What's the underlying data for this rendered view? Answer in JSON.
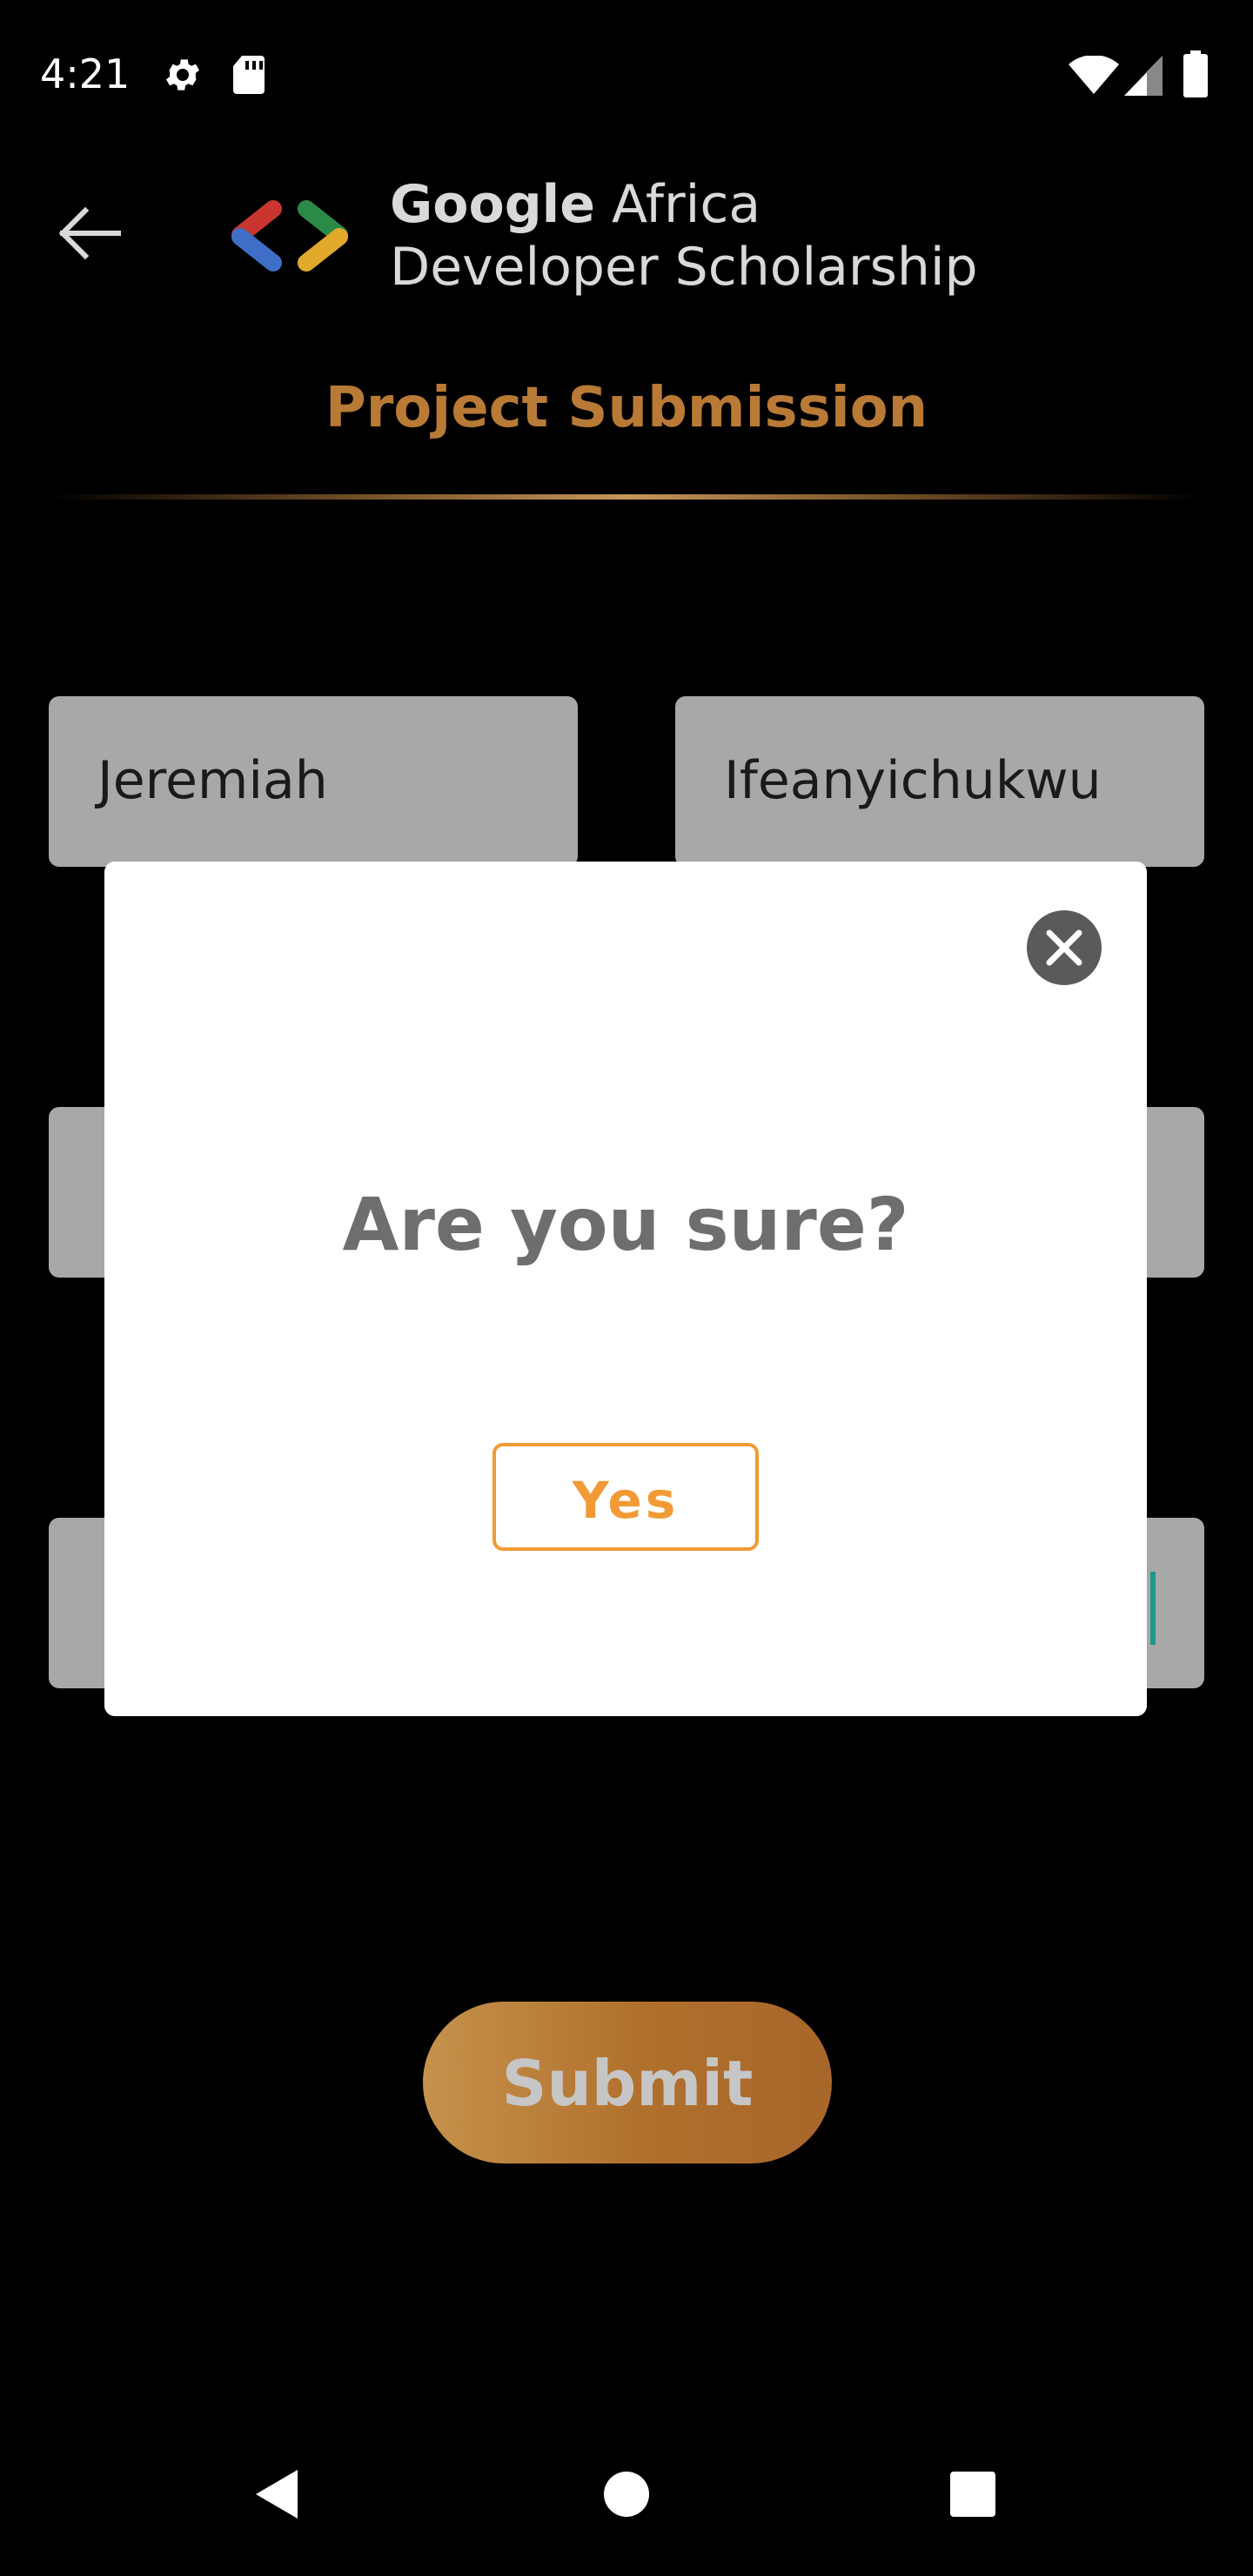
{
  "status_bar": {
    "time": "4:21",
    "left_icons": [
      "gear-icon",
      "sd-card-icon"
    ],
    "right_icons": [
      "wifi-icon",
      "signal-icon",
      "battery-icon"
    ]
  },
  "header": {
    "brand_bold": "Google",
    "brand_rest": " Africa",
    "brand_line2": "Developer Scholarship",
    "page_title": "Project Submission"
  },
  "form": {
    "first_name": "Jeremiah",
    "last_name": "Ifeanyichukwu",
    "email_partial": "",
    "github_partial": ""
  },
  "submit_label": "Submit",
  "dialog": {
    "title": "Are you sure?",
    "confirm_label": "Yes",
    "close_icon": "close-icon"
  },
  "colors": {
    "accent": "#b87a35",
    "dialog_button": "#f29a36",
    "field_bg": "#a8a8a8"
  }
}
